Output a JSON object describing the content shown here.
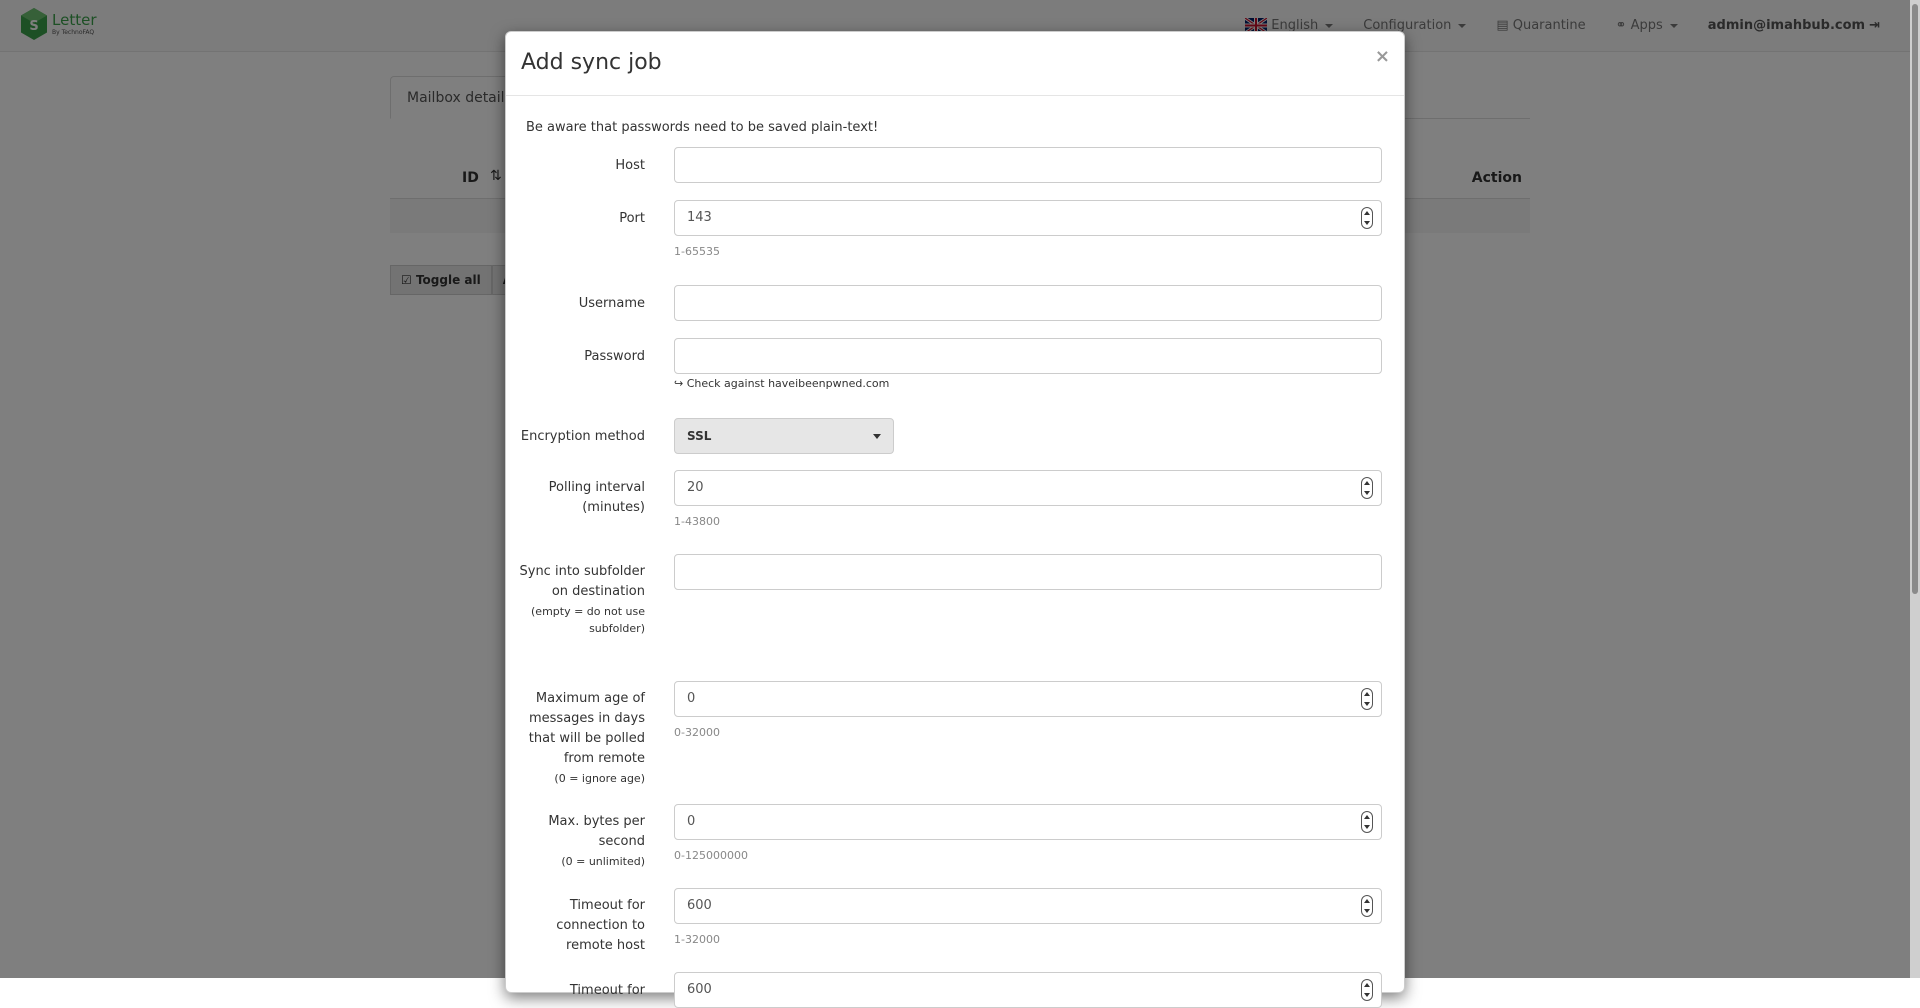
{
  "navbar": {
    "brand_name": "Letter",
    "brand_sub": "By TechnoFAQ",
    "language": "English",
    "configuration": "Configuration",
    "quarantine": "Quarantine",
    "apps": "Apps",
    "user": "admin@imahbub.com"
  },
  "page": {
    "tab_active": "Mailbox details",
    "col_id": "ID",
    "col_action": "Action",
    "toggle_all": "Toggle all",
    "actions_partial": "Acti"
  },
  "modal": {
    "title": "Add sync job",
    "close": "×",
    "warning": "Be aware that passwords need to be saved plain-text!",
    "host": {
      "label": "Host",
      "value": ""
    },
    "port": {
      "label": "Port",
      "value": "143",
      "help": "1-65535"
    },
    "username": {
      "label": "Username",
      "value": ""
    },
    "password": {
      "label": "Password",
      "value": "",
      "hibp": "↪ Check against haveibeenpwned.com"
    },
    "encryption": {
      "label": "Encryption method",
      "value": "SSL"
    },
    "polling": {
      "label_line1": "Polling interval",
      "label_line2": "(minutes)",
      "value": "20",
      "help": "1-43800"
    },
    "subfolder": {
      "label_line1": "Sync into subfolder",
      "label_line2": "on destination",
      "note_line1": "(empty = do not use",
      "note_line2": "subfolder)",
      "value": ""
    },
    "maxage": {
      "label_line1": "Maximum age of",
      "label_line2": "messages in days",
      "label_line3": "that will be polled",
      "label_line4": "from remote",
      "note": "(0 = ignore age)",
      "value": "0",
      "help": "0-32000"
    },
    "maxbytes": {
      "label_line1": "Max. bytes per",
      "label_line2": "second",
      "note": "(0 = unlimited)",
      "value": "0",
      "help": "0-125000000"
    },
    "timeout1": {
      "label_line1": "Timeout for",
      "label_line2": "connection to",
      "label_line3": "remote host",
      "value": "600",
      "help": "1-32000"
    },
    "timeout2": {
      "label_line1": "Timeout for",
      "value": "600"
    }
  },
  "colors": {
    "backdrop": "rgba(0,0,0,0.5)",
    "brand_green": "#3aa14a"
  },
  "icons": [
    "uk-flag-icon",
    "link-icon",
    "archive-icon",
    "logout-icon",
    "check-square-icon",
    "sort-icon",
    "caret-down-icon"
  ]
}
